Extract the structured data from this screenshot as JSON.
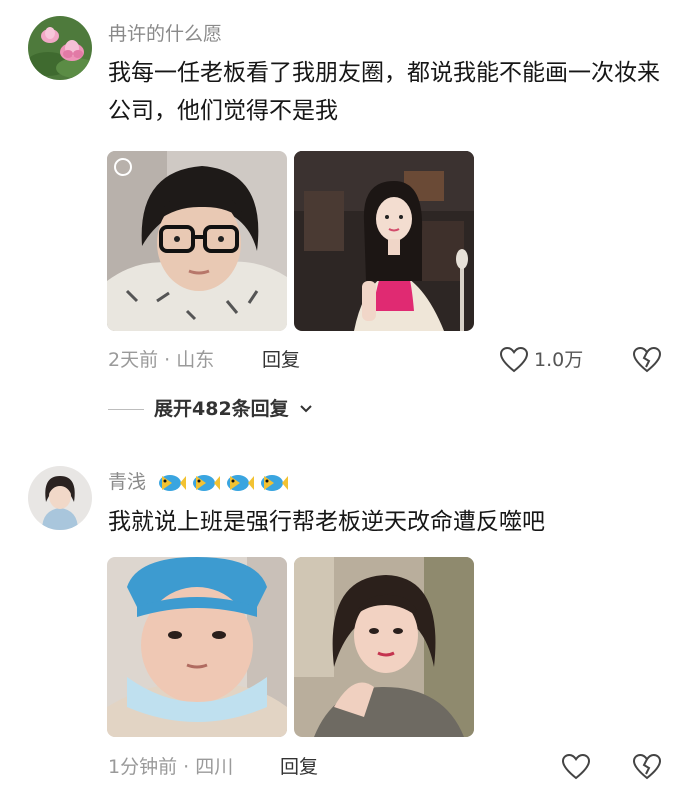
{
  "comments": [
    {
      "username": "冉许的什么愿",
      "text": "我每一任老板看了我朋友圈，都说我能不能画一次妆来公司，他们觉得不是我",
      "meta": "2天前 · 山东",
      "reply_label": "回复",
      "like_count": "1.0万",
      "expand_label": "展开482条回复",
      "avatar_icon": "lotus-flower-avatar",
      "photos": [
        "selfie-glasses-no-makeup",
        "glamour-photo-pink-dress"
      ]
    },
    {
      "username": "青浅",
      "username_decoration": [
        "fish-emoji",
        "fish-emoji",
        "fish-emoji",
        "fish-emoji"
      ],
      "text": "我就说上班是强行帮老板逆天改命遭反噬吧",
      "meta": "1分钟前 · 四川",
      "reply_label": "回复",
      "like_count": "",
      "avatar_icon": "woman-portrait-avatar",
      "photos": [
        "selfie-mask-no-makeup",
        "selfie-with-makeup"
      ]
    }
  ]
}
